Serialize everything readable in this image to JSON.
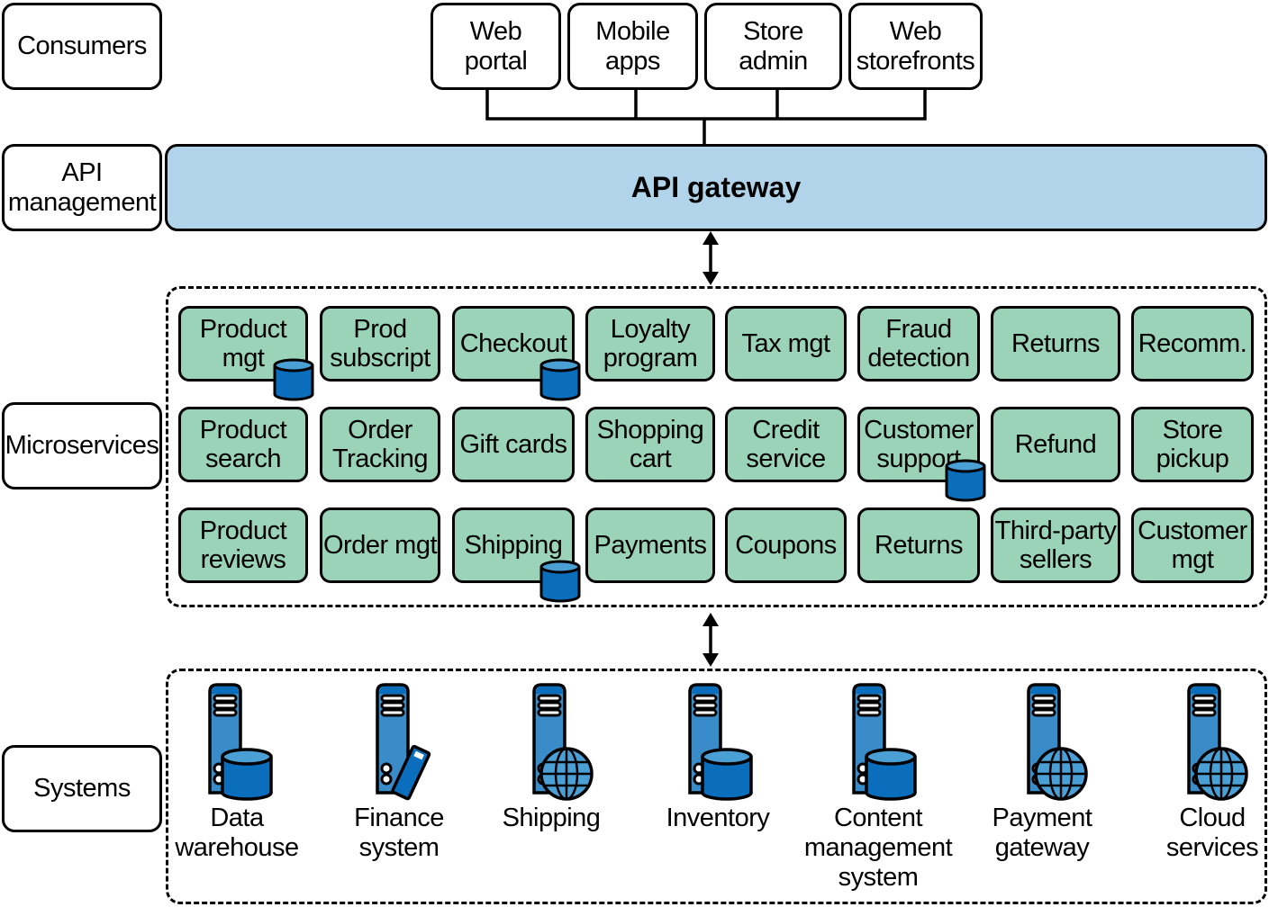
{
  "layers": {
    "consumers": "Consumers",
    "api_management": "API\nmanagement",
    "microservices": "Microservices",
    "systems": "Systems"
  },
  "consumers": [
    "Web\nportal",
    "Mobile\napps",
    "Store\nadmin",
    "Web\nstorefronts"
  ],
  "api_gateway": "API gateway",
  "microservices": [
    [
      {
        "label": "Product\nmgt",
        "db": true
      },
      {
        "label": "Prod\nsubscript"
      },
      {
        "label": "Checkout",
        "db": true
      },
      {
        "label": "Loyalty\nprogram"
      },
      {
        "label": "Tax mgt"
      },
      {
        "label": "Fraud\ndetection"
      },
      {
        "label": "Returns"
      },
      {
        "label": "Recomm."
      }
    ],
    [
      {
        "label": "Product\nsearch"
      },
      {
        "label": "Order\nTracking"
      },
      {
        "label": "Gift cards"
      },
      {
        "label": "Shopping\ncart"
      },
      {
        "label": "Credit\nservice"
      },
      {
        "label": "Customer\nsupport",
        "db": true
      },
      {
        "label": "Refund"
      },
      {
        "label": "Store\npickup"
      }
    ],
    [
      {
        "label": "Product\nreviews"
      },
      {
        "label": "Order mgt"
      },
      {
        "label": "Shipping",
        "db": true
      },
      {
        "label": "Payments"
      },
      {
        "label": "Coupons"
      },
      {
        "label": "Returns"
      },
      {
        "label": "Third-party\nsellers"
      },
      {
        "label": "Customer\nmgt"
      }
    ]
  ],
  "systems": [
    {
      "label": "Data\nwarehouse",
      "icon": "server-database"
    },
    {
      "label": "Finance\nsystem",
      "icon": "server-usb"
    },
    {
      "label": "Shipping",
      "icon": "server-globe"
    },
    {
      "label": "Inventory",
      "icon": "server-database"
    },
    {
      "label": "Content\nmanagement\nsystem",
      "icon": "server-database"
    },
    {
      "label": "Payment\ngateway",
      "icon": "server-globe"
    },
    {
      "label": "Cloud\nservices",
      "icon": "server-globe"
    }
  ],
  "colors": {
    "service": "#9ad3b8",
    "gateway": "#b1d4ea",
    "server": "#3a8cc8",
    "database": "#0a6ebd"
  }
}
